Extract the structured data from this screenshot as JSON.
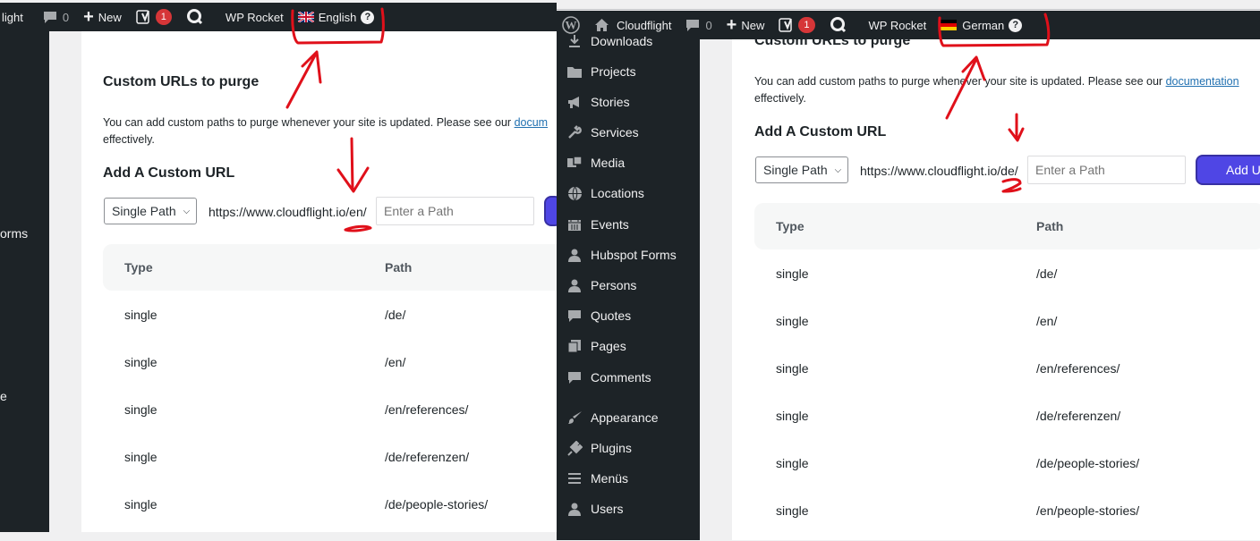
{
  "left": {
    "adminbar": {
      "site_partial": "light",
      "comments_count": "0",
      "new_label": "New",
      "yoast_badge": "1",
      "rocket_label": "WP Rocket",
      "language": "English",
      "help_glyph": "?"
    },
    "sidebar_partials": [
      "orms",
      "e"
    ],
    "section_title": "Custom URLs to purge",
    "description": "You can add custom paths to purge whenever your site is updated. Please see our",
    "doc_link_partial": "docum",
    "description_end": "effectively.",
    "add_title": "Add A Custom URL",
    "select_value": "Single Path",
    "base_url": "https://www.cloudflight.io/en/",
    "path_placeholder": "Enter a Path",
    "table": {
      "headers": [
        "Type",
        "Path"
      ],
      "rows": [
        {
          "type": "single",
          "path": "/de/"
        },
        {
          "type": "single",
          "path": "/en/"
        },
        {
          "type": "single",
          "path": "/en/references/"
        },
        {
          "type": "single",
          "path": "/de/referenzen/"
        },
        {
          "type": "single",
          "path": "/de/people-stories/"
        }
      ]
    }
  },
  "right": {
    "adminbar": {
      "site_name": "Cloudflight",
      "comments_count": "0",
      "new_label": "New",
      "yoast_badge": "1",
      "rocket_label": "WP Rocket",
      "language": "German",
      "help_glyph": "?"
    },
    "sidebar": {
      "items": [
        {
          "label": "Downloads",
          "icon": "download-icon"
        },
        {
          "label": "Projects",
          "icon": "folder-icon"
        },
        {
          "label": "Stories",
          "icon": "megaphone-icon"
        },
        {
          "label": "Services",
          "icon": "wrench-icon"
        },
        {
          "label": "Media",
          "icon": "media-icon"
        },
        {
          "label": "Locations",
          "icon": "globe-icon"
        },
        {
          "label": "Events",
          "icon": "calendar-icon"
        },
        {
          "label": "Hubspot Forms",
          "icon": "person-icon"
        },
        {
          "label": "Persons",
          "icon": "person-icon"
        },
        {
          "label": "Quotes",
          "icon": "comment-icon"
        },
        {
          "label": "Pages",
          "icon": "pages-icon"
        },
        {
          "label": "Comments",
          "icon": "comment-icon"
        },
        {
          "label": "Appearance",
          "icon": "brush-icon"
        },
        {
          "label": "Plugins",
          "icon": "plugin-icon"
        },
        {
          "label": "Menüs",
          "icon": "menu-icon"
        },
        {
          "label": "Users",
          "icon": "person-icon"
        }
      ]
    },
    "section_title": "Custom URLs to purge",
    "description": "You can add custom paths to purge whenever your site is updated. Please see our",
    "doc_link": "documentation",
    "description_end": "effectively.",
    "add_title": "Add A Custom URL",
    "select_value": "Single Path",
    "base_url": "https://www.cloudflight.io/de/",
    "path_placeholder": "Enter a Path",
    "add_button": "Add U",
    "table": {
      "headers": [
        "Type",
        "Path"
      ],
      "rows": [
        {
          "type": "single",
          "path": "/de/"
        },
        {
          "type": "single",
          "path": "/en/"
        },
        {
          "type": "single",
          "path": "/en/references/"
        },
        {
          "type": "single",
          "path": "/de/referenzen/"
        },
        {
          "type": "single",
          "path": "/de/people-stories/"
        },
        {
          "type": "single",
          "path": "/en/people-stories/"
        }
      ]
    }
  },
  "colors": {
    "adminbar": "#1d2327",
    "annotation": "#e0101a",
    "accent_button": "#4f46e5",
    "badge": "#d63638",
    "link": "#2271b1"
  }
}
